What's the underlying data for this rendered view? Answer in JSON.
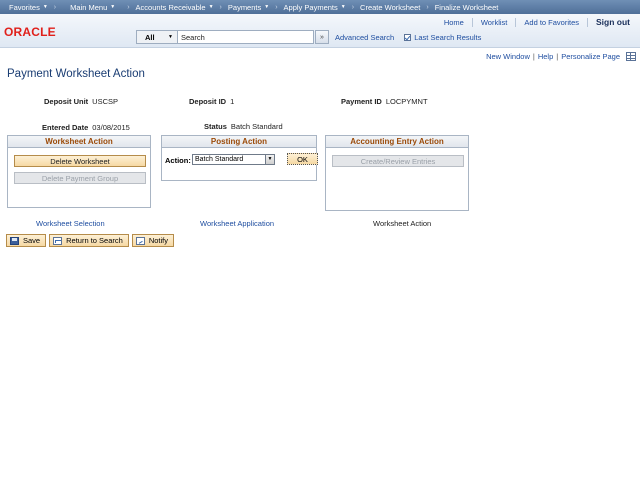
{
  "topnav": {
    "favorites": "Favorites",
    "main_menu": "Main Menu",
    "breadcrumbs": [
      "Accounts Receivable",
      "Payments",
      "Apply Payments",
      "Create Worksheet",
      "Finalize Worksheet"
    ]
  },
  "header": {
    "logo": "ORACLE",
    "links": [
      "Home",
      "Worklist",
      "Add to Favorites",
      "Sign out"
    ]
  },
  "search": {
    "scope": "All",
    "placeholder": "Search",
    "go": "»",
    "advanced": "Advanced Search",
    "last_results": "Last Search Results"
  },
  "pagebar": {
    "new_window": "New Window",
    "help": "Help",
    "personalize": "Personalize Page"
  },
  "page_title": "Payment Worksheet Action",
  "fields": {
    "deposit_unit_label": "Deposit Unit",
    "deposit_unit_value": "USCSP",
    "deposit_id_label": "Deposit ID",
    "deposit_id_value": "1",
    "payment_id_label": "Payment ID",
    "payment_id_value": "LOCPYMNT",
    "entered_date_label": "Entered Date",
    "entered_date_value": "03/08/2015",
    "status_label": "Status",
    "status_value": "Batch Standard"
  },
  "worksheet_action": {
    "title": "Worksheet Action",
    "delete_worksheet": "Delete Worksheet",
    "delete_payment_group": "Delete Payment Group"
  },
  "posting_action": {
    "title": "Posting Action",
    "action_label": "Action:",
    "action_value": "Batch Standard",
    "ok": "OK"
  },
  "accounting_entry_action": {
    "title": "Accounting Entry Action",
    "create_review": "Create/Review Entries"
  },
  "tabs": {
    "worksheet_selection": "Worksheet Selection",
    "worksheet_application": "Worksheet Application",
    "worksheet_action": "Worksheet Action"
  },
  "toolbar": {
    "save": "Save",
    "return_to_search": "Return to Search",
    "notify": "Notify"
  }
}
